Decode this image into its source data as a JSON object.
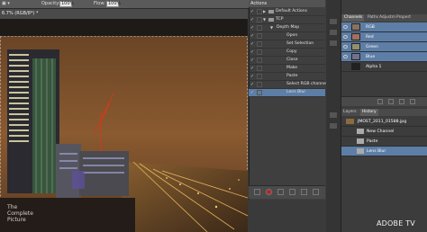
{
  "options_bar": {
    "opacity_label": "Opacity:",
    "opacity_value": "100%",
    "flow_label": "Flow:",
    "flow_value": "100%"
  },
  "document": {
    "tab_title": "6.7% (RGB/8*) *",
    "watermark": [
      "The",
      "Complete",
      "Picture"
    ]
  },
  "actions_panel": {
    "title": "Actions",
    "items": [
      {
        "label": "Default Actions",
        "level": 0,
        "folder": true,
        "expanded": false
      },
      {
        "label": "TCP",
        "level": 0,
        "folder": true,
        "expanded": true
      },
      {
        "label": "Depth Map",
        "level": 1,
        "expanded": true
      },
      {
        "label": "Open",
        "level": 2
      },
      {
        "label": "Set Selection",
        "level": 2
      },
      {
        "label": "Copy",
        "level": 2
      },
      {
        "label": "Close",
        "level": 2
      },
      {
        "label": "Make",
        "level": 2
      },
      {
        "label": "Paste",
        "level": 2
      },
      {
        "label": "Select RGB channel",
        "level": 2
      },
      {
        "label": "Lens Blur",
        "level": 2,
        "selected": true
      }
    ]
  },
  "channels_panel": {
    "tabs": [
      "Channels",
      "Paths",
      "Adjustm",
      "Propert"
    ],
    "active_tab": "Channels",
    "rows": [
      {
        "name": "RGB",
        "shortcut": "",
        "selected": true
      },
      {
        "name": "Red",
        "shortcut": "",
        "selected": true
      },
      {
        "name": "Green",
        "shortcut": "",
        "selected": true
      },
      {
        "name": "Blue",
        "shortcut": "",
        "selected": true
      },
      {
        "name": "Alpha 1",
        "shortcut": "",
        "selected": false
      }
    ]
  },
  "history_panel": {
    "tabs": [
      "Layers",
      "History"
    ],
    "active_tab": "History",
    "snapshot": "JMOST_2011_01588.jpg",
    "rows": [
      {
        "name": "New Channel",
        "selected": false
      },
      {
        "name": "Paste",
        "selected": false
      },
      {
        "name": "Lens Blur",
        "selected": true
      }
    ]
  },
  "branding": {
    "logo_text": "ADOBE TV"
  },
  "colors": {
    "selection": "#5d7ea6",
    "panel_bg": "#3f3f3f"
  }
}
